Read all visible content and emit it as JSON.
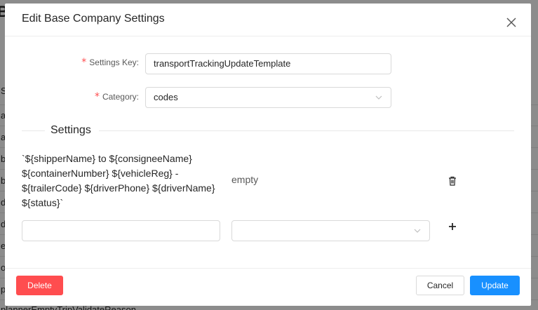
{
  "background": {
    "title_fragment": "Ba",
    "rows": [
      "S",
      "a",
      "a",
      "b",
      "b",
      "d",
      "d",
      "e",
      "o",
      "p",
      "plannerEmptyTripValidateReason"
    ]
  },
  "modal": {
    "title": "Edit Base Company Settings",
    "close_icon": "close-icon",
    "form": {
      "settings_key_label": "Settings Key",
      "settings_key_value": "transportTrackingUpdateTemplate",
      "category_label": "Category",
      "category_value": "codes",
      "required_marker": "*"
    },
    "settings_section_title": "Settings",
    "settings_rows": [
      {
        "key": "`${shipperName} to ${consigneeName} ${containerNumber} ${vehicleReg} - ${trailerCode} ${driverPhone} ${driverName} ${status}`",
        "value": "empty",
        "icon": "trash-icon"
      }
    ],
    "new_row": {
      "key_value": "",
      "value_value": "",
      "icon": "plus-icon"
    },
    "footer": {
      "delete_label": "Delete",
      "cancel_label": "Cancel",
      "update_label": "Update"
    }
  },
  "colors": {
    "primary": "#1890ff",
    "danger": "#ff4d4f",
    "required": "#ff4d4f"
  }
}
